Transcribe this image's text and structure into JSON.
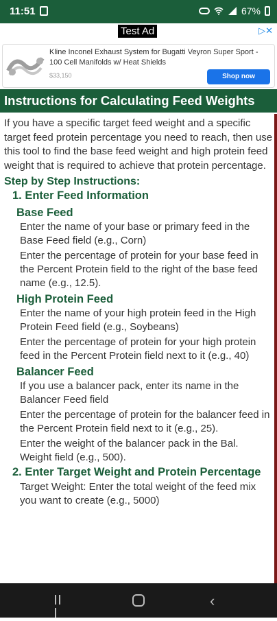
{
  "status_bar": {
    "time": "11:51",
    "battery": "67%"
  },
  "ad": {
    "label": "Test Ad",
    "title": "Kline Inconel Exhaust System for Bugatti Veyron Super Sport - 100 Cell Manifolds w/ Heat Shields",
    "price": "$33,150",
    "button": "Shop now"
  },
  "page": {
    "title": "Instructions for Calculating Feed Weights",
    "intro": "If you have a specific target feed weight and a specific target feed protein percentage you need to reach, then use this tool to find the base feed weight and high protein feed weight that is required to achieve that protein percentage.",
    "steps_heading": "Step by Step Instructions:",
    "step1": {
      "heading": "1. Enter Feed Information",
      "base": {
        "heading": "Base Feed",
        "p1": "Enter the name of your base or primary feed in the Base Feed field (e.g., Corn)",
        "p2": "Enter the percentage of protein for your base feed in the Percent Protein field to the right of the base feed name (e.g., 12.5)."
      },
      "high": {
        "heading": "High Protein Feed",
        "p1": "Enter the name of your high protein feed in the High Protein Feed field (e.g., Soybeans)",
        "p2": "Enter the percentage of protein for your high protein feed in the Percent Protein field next to it (e.g., 40)"
      },
      "balancer": {
        "heading": "Balancer Feed",
        "p1": "If you use a balancer pack, enter its name in the Balancer Feed field",
        "p2": "Enter the percentage of protein for the balancer feed in the Percent Protein field next to it (e.g., 25).",
        "p3": "Enter the weight of the balancer pack in the Bal. Weight field (e.g., 500)."
      }
    },
    "step2": {
      "heading": "2. Enter Target Weight and Protein Percentage",
      "p1": "Target Weight: Enter the total weight of the feed mix you want to create (e.g., 5000)"
    }
  }
}
